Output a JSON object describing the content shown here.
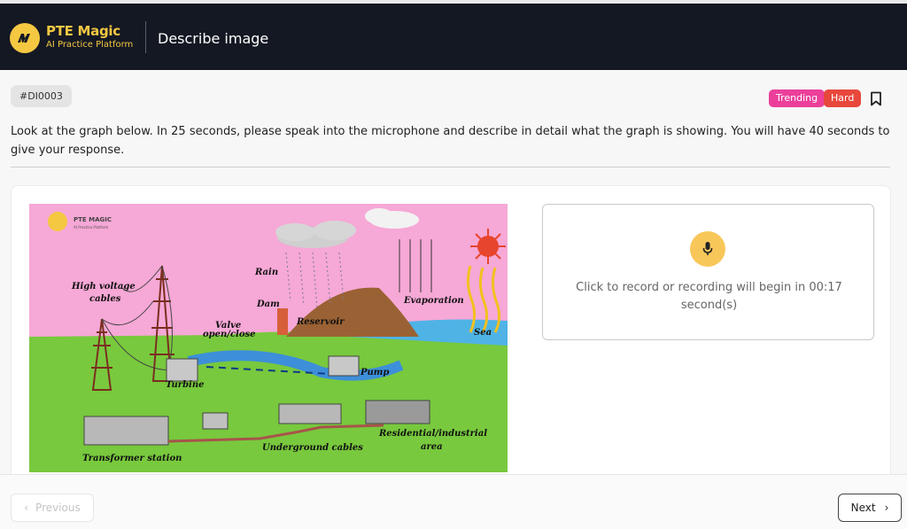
{
  "header": {
    "brand_name": "PTE Magic",
    "brand_sub": "AI Practice Platform",
    "title": "Describe image"
  },
  "question": {
    "id": "#DI0003",
    "badges": {
      "trending": "Trending",
      "difficulty": "Hard"
    },
    "instructions": "Look at the graph below. In 25 seconds, please speak into the microphone and describe in detail what the graph is showing. You will have 40 seconds to give your response."
  },
  "diagram": {
    "watermark_title": "PTE MAGIC",
    "watermark_sub": "AI Practice Platform",
    "labels": {
      "rain": "Rain",
      "dam": "Dam",
      "reservoir": "Reservoir",
      "evaporation": "Evaporation",
      "sea": "Sea",
      "high_voltage_1": "High voltage",
      "high_voltage_2": "cables",
      "valve_1": "Valve",
      "valve_2": "open/close",
      "turbine": "Turbine",
      "pump": "Pump",
      "transformer": "Transformer station",
      "underground": "Underground cables",
      "residential_1": "Residential/industrial",
      "residential_2": "area"
    }
  },
  "recorder": {
    "text": "Click to record or recording will begin in 00:17 second(s)"
  },
  "nav": {
    "previous": "Previous",
    "next": "Next"
  },
  "colors": {
    "header_bg": "#141823",
    "brand_yellow": "#f5c842",
    "trending": "#ec3f9a",
    "hard": "#e8473c",
    "mic": "#f8c75a"
  }
}
